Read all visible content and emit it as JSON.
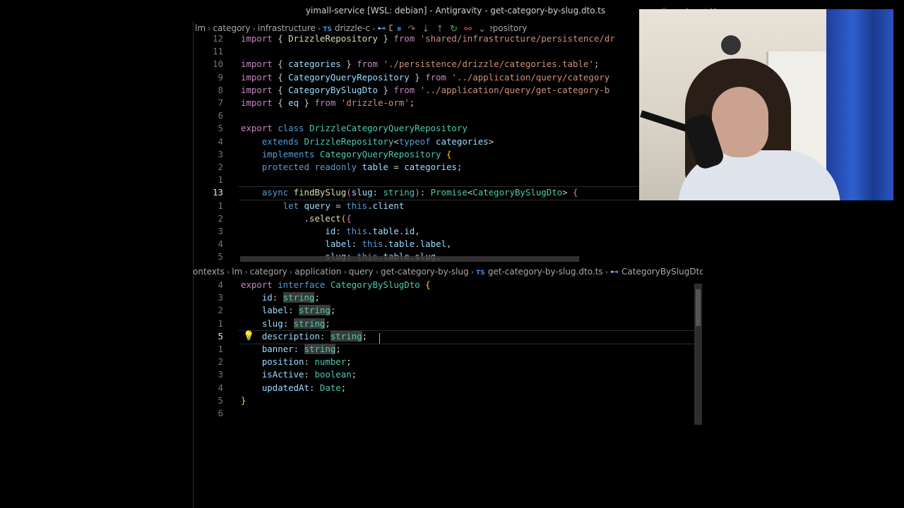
{
  "window": {
    "title": "yimall-service [WSL: debian] - Antigravity - get-category-by-slug.dto.ts",
    "right_partial": "Open Agent Manager"
  },
  "top_breadcrumb": {
    "items": [
      "lm",
      "category",
      "infrastructure"
    ],
    "file_icon": "TS",
    "file": "drizzle-c",
    "symbol": "DrizzleCategoryQueryRepository"
  },
  "debug_toolbar": {
    "buttons": [
      {
        "name": "pause-icon",
        "glyph": "⏸",
        "color": "#4a8bd6"
      },
      {
        "name": "step-over-icon",
        "glyph": "↷",
        "color": "#777"
      },
      {
        "name": "step-into-icon",
        "glyph": "↓",
        "color": "#777"
      },
      {
        "name": "step-out-icon",
        "glyph": "↑",
        "color": "#777"
      },
      {
        "name": "restart-icon",
        "glyph": "↻",
        "color": "#4caf50"
      },
      {
        "name": "disconnect-icon",
        "glyph": "⚯",
        "color": "#e05555"
      },
      {
        "name": "chevron-down-icon",
        "glyph": "⌄",
        "color": "#999"
      }
    ]
  },
  "top_editor": {
    "lines": [
      {
        "num": "12",
        "tokens": [
          [
            "kw",
            "import "
          ],
          [
            "pun",
            "{ "
          ],
          [
            "fn",
            "DrizzleRepository"
          ],
          [
            "pun",
            " } "
          ],
          [
            "kw",
            "from "
          ],
          [
            "str",
            "'shared/infrastructure/persistence/dr"
          ]
        ]
      },
      {
        "num": "11",
        "tokens": []
      },
      {
        "num": "10",
        "tokens": [
          [
            "kw",
            "import "
          ],
          [
            "pun",
            "{ "
          ],
          [
            "var",
            "categories"
          ],
          [
            "pun",
            " } "
          ],
          [
            "kw",
            "from "
          ],
          [
            "str",
            "'./persistence/drizzle/categories.table'"
          ],
          [
            "pun",
            ";"
          ]
        ]
      },
      {
        "num": "9",
        "tokens": [
          [
            "kw",
            "import "
          ],
          [
            "pun",
            "{ "
          ],
          [
            "var",
            "CategoryQueryRepository"
          ],
          [
            "pun",
            " } "
          ],
          [
            "kw",
            "from "
          ],
          [
            "str",
            "'../application/query/category"
          ]
        ]
      },
      {
        "num": "8",
        "tokens": [
          [
            "kw",
            "import "
          ],
          [
            "pun",
            "{ "
          ],
          [
            "var",
            "CategoryBySlugDto"
          ],
          [
            "pun",
            " } "
          ],
          [
            "kw",
            "from "
          ],
          [
            "str",
            "'../application/query/get-category-b"
          ]
        ]
      },
      {
        "num": "7",
        "tokens": [
          [
            "kw",
            "import "
          ],
          [
            "pun",
            "{ "
          ],
          [
            "var",
            "eq"
          ],
          [
            "pun",
            " } "
          ],
          [
            "kw",
            "from "
          ],
          [
            "str",
            "'drizzle-orm'"
          ],
          [
            "pun",
            ";"
          ]
        ]
      },
      {
        "num": "6",
        "tokens": []
      },
      {
        "num": "5",
        "tokens": [
          [
            "kw",
            "export "
          ],
          [
            "kb",
            "class "
          ],
          [
            "type",
            "DrizzleCategoryQueryRepository"
          ]
        ]
      },
      {
        "num": "4",
        "tokens": [
          [
            "pun",
            "    "
          ],
          [
            "kb",
            "extends "
          ],
          [
            "type",
            "DrizzleRepository"
          ],
          [
            "pun",
            "<"
          ],
          [
            "kb",
            "typeof "
          ],
          [
            "var",
            "categories"
          ],
          [
            "pun",
            ">"
          ]
        ]
      },
      {
        "num": "3",
        "tokens": [
          [
            "pun",
            "    "
          ],
          [
            "kb",
            "implements "
          ],
          [
            "type",
            "CategoryQueryRepository"
          ],
          [
            "pun",
            " "
          ],
          [
            "br1",
            "{"
          ]
        ]
      },
      {
        "num": "2",
        "tokens": [
          [
            "pun",
            "    "
          ],
          [
            "kb",
            "protected "
          ],
          [
            "kb",
            "readonly "
          ],
          [
            "var",
            "table"
          ],
          [
            "pun",
            " = "
          ],
          [
            "var",
            "categories"
          ],
          [
            "pun",
            ";"
          ]
        ]
      },
      {
        "num": "1",
        "tokens": []
      },
      {
        "num": "13",
        "cur": true,
        "tokens": [
          [
            "pun",
            "    "
          ],
          [
            "kb",
            "async "
          ],
          [
            "fn",
            "findBySlug"
          ],
          [
            "br2",
            "("
          ],
          [
            "var",
            "slug"
          ],
          [
            "pun",
            ": "
          ],
          [
            "type",
            "string"
          ],
          [
            "br2",
            ")"
          ],
          [
            "pun",
            ": "
          ],
          [
            "type",
            "Promise"
          ],
          [
            "pun",
            "<"
          ],
          [
            "type",
            "CategoryBySlugDto"
          ],
          [
            "pun",
            "> "
          ],
          [
            "br2",
            "{"
          ]
        ]
      },
      {
        "num": "1",
        "tokens": [
          [
            "pun",
            "        "
          ],
          [
            "kb",
            "let "
          ],
          [
            "var",
            "query"
          ],
          [
            "pun",
            " = "
          ],
          [
            "kb",
            "this"
          ],
          [
            "pun",
            "."
          ],
          [
            "var",
            "client"
          ]
        ]
      },
      {
        "num": "2",
        "tokens": [
          [
            "pun",
            "            ."
          ],
          [
            "fn",
            "select"
          ],
          [
            "br1",
            "("
          ],
          [
            "br2",
            "{"
          ]
        ]
      },
      {
        "num": "3",
        "tokens": [
          [
            "pun",
            "                "
          ],
          [
            "var",
            "id"
          ],
          [
            "pun",
            ": "
          ],
          [
            "kb",
            "this"
          ],
          [
            "pun",
            "."
          ],
          [
            "var",
            "table"
          ],
          [
            "pun",
            "."
          ],
          [
            "var",
            "id"
          ],
          [
            "pun",
            ","
          ]
        ]
      },
      {
        "num": "4",
        "tokens": [
          [
            "pun",
            "                "
          ],
          [
            "var",
            "label"
          ],
          [
            "pun",
            ": "
          ],
          [
            "kb",
            "this"
          ],
          [
            "pun",
            "."
          ],
          [
            "var",
            "table"
          ],
          [
            "pun",
            "."
          ],
          [
            "var",
            "label"
          ],
          [
            "pun",
            ","
          ]
        ]
      },
      {
        "num": "5",
        "tokens": [
          [
            "pun",
            "                "
          ],
          [
            "var",
            "slug"
          ],
          [
            "pun",
            ": "
          ],
          [
            "kb",
            "this"
          ],
          [
            "pun",
            "."
          ],
          [
            "var",
            "table"
          ],
          [
            "pun",
            "."
          ],
          [
            "var",
            "slug"
          ],
          [
            "pun",
            ","
          ]
        ]
      }
    ]
  },
  "bottom_breadcrumb": {
    "items": [
      "ontexts",
      "lm",
      "category",
      "application",
      "query",
      "get-category-by-slug"
    ],
    "file_icon": "TS",
    "file": "get-category-by-slug.dto.ts",
    "symbol": "CategoryBySlugDto"
  },
  "bottom_editor": {
    "lines": [
      {
        "num": "4",
        "tokens": [
          [
            "kw",
            "export "
          ],
          [
            "kb",
            "interface "
          ],
          [
            "type",
            "CategoryBySlugDto"
          ],
          [
            "pun",
            " "
          ],
          [
            "br1",
            "{"
          ]
        ]
      },
      {
        "num": "3",
        "tokens": [
          [
            "pun",
            "    "
          ],
          [
            "var",
            "id"
          ],
          [
            "pun",
            ": "
          ],
          [
            "type hl",
            "string"
          ],
          [
            "pun",
            ";"
          ]
        ]
      },
      {
        "num": "2",
        "tokens": [
          [
            "pun",
            "    "
          ],
          [
            "var",
            "label"
          ],
          [
            "pun",
            ": "
          ],
          [
            "type hl",
            "string"
          ],
          [
            "pun",
            ";"
          ]
        ]
      },
      {
        "num": "1",
        "tokens": [
          [
            "pun",
            "    "
          ],
          [
            "var",
            "slug"
          ],
          [
            "pun",
            ": "
          ],
          [
            "type hl",
            "string"
          ],
          [
            "pun",
            ";"
          ]
        ]
      },
      {
        "num": "5",
        "cur": true,
        "tokens": [
          [
            "pun",
            "    "
          ],
          [
            "var",
            "description"
          ],
          [
            "pun",
            ": "
          ],
          [
            "type hl",
            "string"
          ],
          [
            "pun",
            ";"
          ]
        ]
      },
      {
        "num": "1",
        "tokens": [
          [
            "pun",
            "    "
          ],
          [
            "var",
            "banner"
          ],
          [
            "pun",
            ": "
          ],
          [
            "type hl",
            "string"
          ],
          [
            "pun",
            ";"
          ]
        ]
      },
      {
        "num": "2",
        "tokens": [
          [
            "pun",
            "    "
          ],
          [
            "var",
            "position"
          ],
          [
            "pun",
            ": "
          ],
          [
            "type",
            "number"
          ],
          [
            "pun",
            ";"
          ]
        ]
      },
      {
        "num": "3",
        "tokens": [
          [
            "pun",
            "    "
          ],
          [
            "var",
            "isActive"
          ],
          [
            "pun",
            ": "
          ],
          [
            "type",
            "boolean"
          ],
          [
            "pun",
            ";"
          ]
        ]
      },
      {
        "num": "4",
        "tokens": [
          [
            "pun",
            "    "
          ],
          [
            "var",
            "updatedAt"
          ],
          [
            "pun",
            ": "
          ],
          [
            "type",
            "Date"
          ],
          [
            "pun",
            ";"
          ]
        ]
      },
      {
        "num": "5",
        "tokens": [
          [
            "br1",
            "}"
          ]
        ]
      },
      {
        "num": "6",
        "tokens": []
      }
    ]
  }
}
